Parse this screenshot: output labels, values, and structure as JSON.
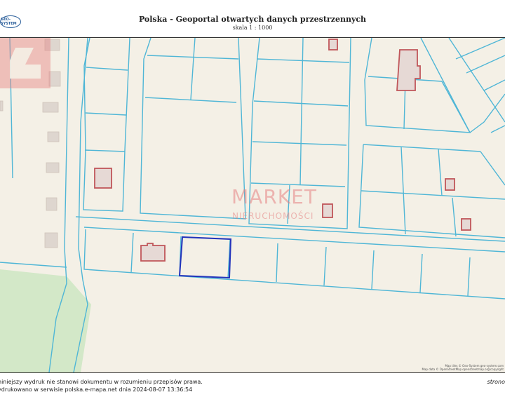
{
  "header": {
    "logo_text": "GEO-SYSTEM",
    "title": "Polska - Geoportal otwartych danych przestrzennych",
    "scale": "skala 1 : 1000"
  },
  "map": {
    "colors": {
      "background": "#f4f0e6",
      "parcel_line": "#4fb6d6",
      "building_fill": "#e6d9d5",
      "building_stroke": "#c0565a",
      "selected_parcel": "#2233bb",
      "green_area": "#d3e8c8"
    },
    "watermark": {
      "line1": "MARKET",
      "line2": "NIERUCHOMOŚCI"
    },
    "credits": {
      "line1": "Map tiles © Geo-System geo-system.com",
      "line2": "Map data © OpenStreetMap openstreetmap.org/copyright"
    }
  },
  "footer": {
    "line1": "niniejszy wydruk nie stanowi dokumentu w rozumieniu przepisów prawa.",
    "line2": "ydrukowano w serwisie polska.e-mapa.net dnia 2024-08-07 13:36:54",
    "page_label": "strono"
  }
}
